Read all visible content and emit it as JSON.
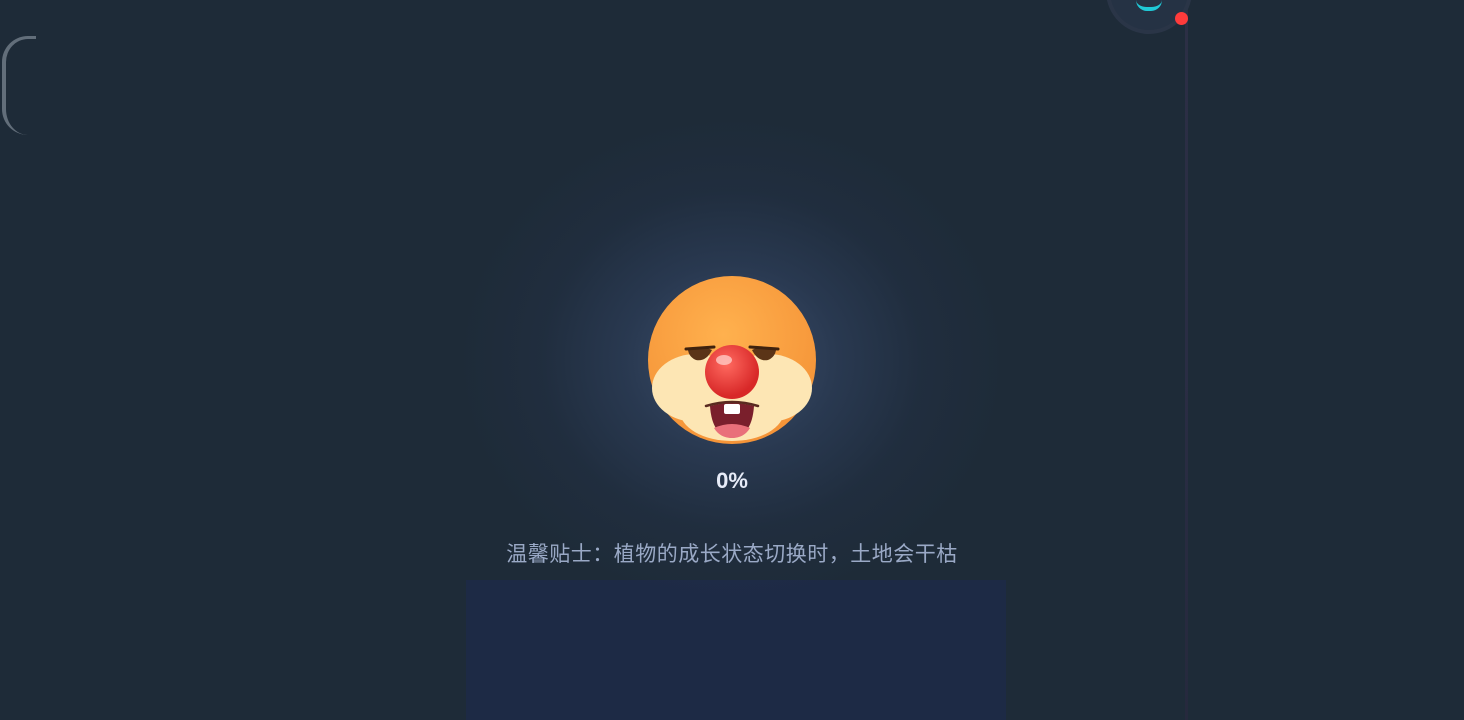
{
  "loading": {
    "progress_label": "0%",
    "progress_value": 0,
    "tip": "温馨贴士：植物的成长状态切换时，土地会干枯"
  },
  "colors": {
    "background": "#1e2b38",
    "glow": "#4a5c80",
    "progress_text": "#e7ecf8",
    "tip_text": "#9aa9c6",
    "mascot_face": "#f7a34a",
    "mascot_nose": "#ee3b3b",
    "notification_dot": "#ff3b3b",
    "widget_accent": "#20c8d6"
  },
  "icons": {
    "mascot": "clown-mascot-icon",
    "top_right": "status-widget-icon"
  }
}
